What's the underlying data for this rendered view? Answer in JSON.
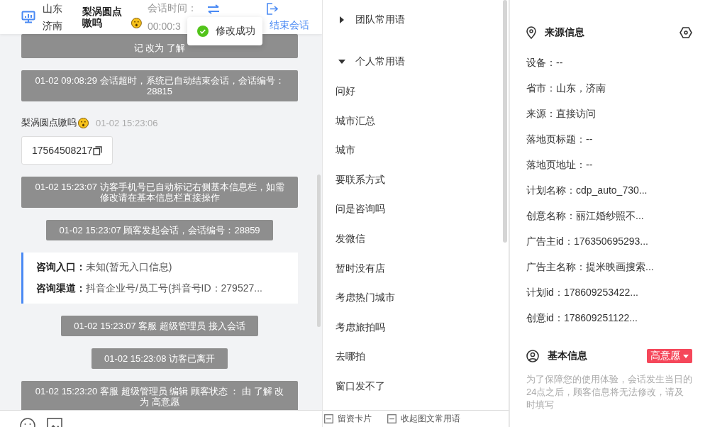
{
  "header": {
    "location_lines": [
      "山东",
      "济南"
    ],
    "visitor_name": "梨涡圆点嗷呜",
    "session_time_label": "会话时间：",
    "session_time": "00:00:3",
    "end_label": "结束会话"
  },
  "toast": {
    "text": "修改成功"
  },
  "messages": [
    {
      "kind": "system_clipped",
      "text": "记 改为 了解"
    },
    {
      "kind": "system",
      "text": "01-02 09:08:29 会话超时，系统已自动结束会话，会话编号：28815"
    },
    {
      "kind": "visitor",
      "name": "梨涡圆点嗷呜",
      "time": "01-02 15:23:06",
      "phone": "17564508217"
    },
    {
      "kind": "system",
      "text": "01-02 15:23:07 访客手机号已自动标记右侧基本信息栏，如需修改请在基本信息栏直接操作"
    },
    {
      "kind": "system",
      "text": "01-02 15:23:07 顾客发起会话，会话编号：28859"
    },
    {
      "kind": "info",
      "lines": [
        {
          "label": "咨询入口：",
          "value": "未知(暂无入口信息)"
        },
        {
          "label": "咨询渠道：",
          "value": "抖音企业号/员工号(抖音号ID：279527..."
        }
      ]
    },
    {
      "kind": "system",
      "text": "01-02 15:23:07 客服 超级管理员 接入会话"
    },
    {
      "kind": "system",
      "text": "01-02 15:23:08 访客已离开"
    },
    {
      "kind": "system",
      "text": "01-02 15:23:20 客服 超级管理员 编辑 顾客状态 ： 由 了解 改为 高意愿"
    }
  ],
  "phrase_groups": [
    {
      "label": "团队常用语",
      "expanded": false
    },
    {
      "label": "个人常用语",
      "expanded": true,
      "children": [
        "问好",
        "城市汇总",
        "城市",
        "要联系方式",
        "问是咨询吗",
        "发微信",
        "暂时没有店",
        "考虑热门城市",
        "考虑旅拍吗",
        "去哪拍",
        "窗口发不了"
      ]
    }
  ],
  "phrase_footer": [
    "留资卡片",
    "收起图文常用语"
  ],
  "source_info": {
    "title": "来源信息",
    "fields": [
      "设备：--",
      "省市：山东，济南",
      "来源：直接访问",
      "落地页标题：--",
      "落地页地址：--",
      "计划名称：cdp_auto_730...",
      "创意名称：丽江婚纱照不...",
      "广告主id：176350695293...",
      "广告主名称：提米映画搜索...",
      "计划id：178609253422...",
      "创意id：178609251122..."
    ]
  },
  "basic_info": {
    "title": "基本信息",
    "intent": {
      "label": "高意愿",
      "color": "#f5475a"
    },
    "note": "为了保障您的使用体验，会话发生当日的24点之后，顾客信息将无法修改，请及时填写"
  }
}
